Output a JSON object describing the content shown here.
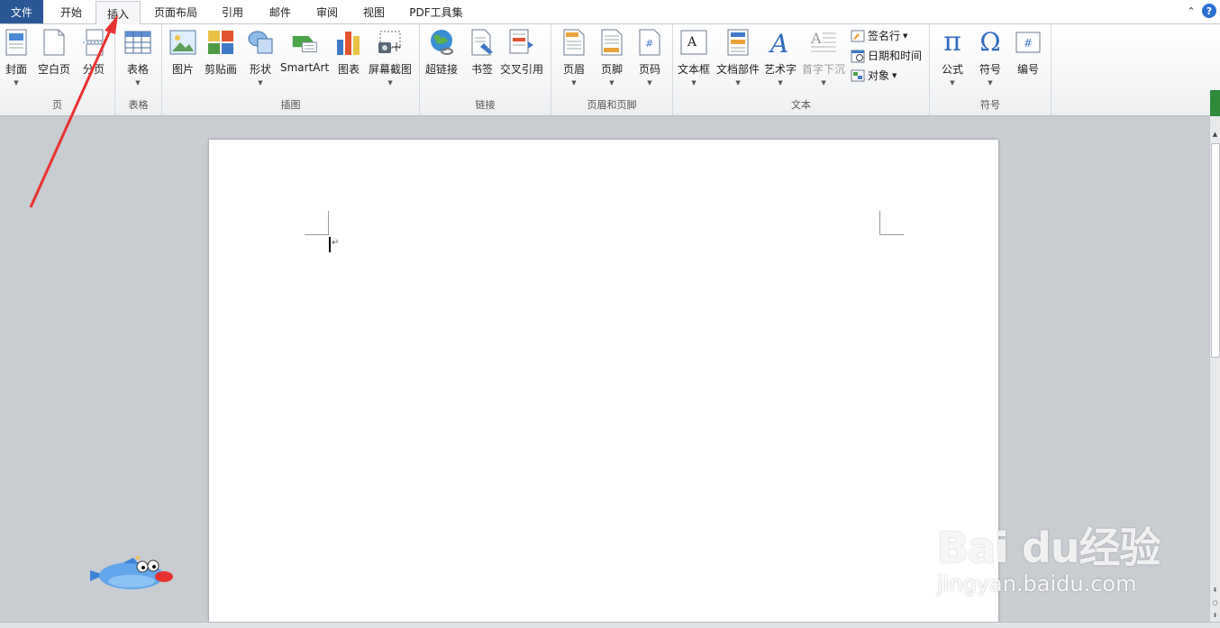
{
  "tabs": {
    "file": "文件",
    "items": [
      "开始",
      "插入",
      "页面布局",
      "引用",
      "邮件",
      "审阅",
      "视图",
      "PDF工具集"
    ],
    "active": "插入"
  },
  "ribbon": {
    "pages": {
      "label": "页",
      "cover": "封面",
      "blank": "空白页",
      "break": "分页"
    },
    "table": {
      "label": "表格",
      "table": "表格"
    },
    "illustrations": {
      "label": "插图",
      "picture": "图片",
      "clipart": "剪贴画",
      "shapes": "形状",
      "smartart": "SmartArt",
      "chart": "图表",
      "screenshot": "屏幕截图"
    },
    "links": {
      "label": "链接",
      "hyperlink": "超链接",
      "bookmark": "书签",
      "crossref": "交叉引用"
    },
    "headerfooter": {
      "label": "页眉和页脚",
      "header": "页眉",
      "footer": "页脚",
      "pagenum": "页码"
    },
    "text": {
      "label": "文本",
      "textbox": "文本框",
      "quickparts": "文档部件",
      "wordart": "艺术字",
      "dropcap": "首字下沉",
      "signature": "签名行",
      "datetime": "日期和时间",
      "object": "对象"
    },
    "symbols": {
      "label": "符号",
      "equation": "公式",
      "symbol": "符号",
      "number": "编号"
    }
  },
  "document": {
    "para_mark": "↵"
  },
  "watermark": {
    "brand": "Bai du经验",
    "url": "jingyan.baidu.com"
  },
  "colors": {
    "file_tab": "#2b5797",
    "arrow": "#e8322f",
    "ribbon_bg": "#f4f5f6",
    "workspace": "#c9ccd1"
  }
}
